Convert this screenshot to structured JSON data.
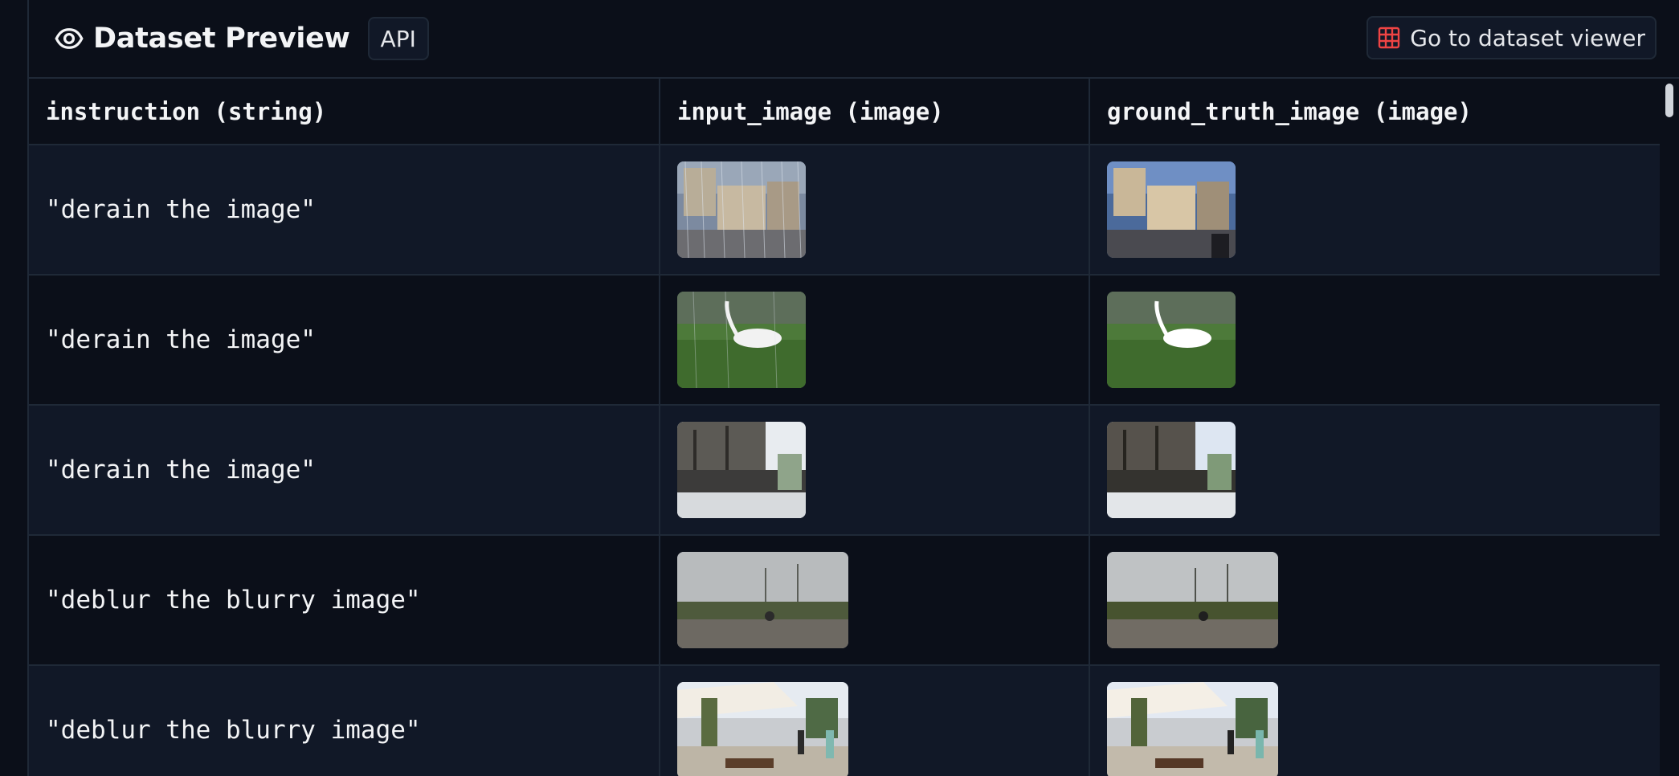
{
  "header": {
    "title": "Dataset Preview",
    "api_label": "API",
    "viewer_button_label": "Go to dataset viewer",
    "eye_icon": "eye-icon",
    "viewer_icon": "grid-icon",
    "viewer_icon_color": "#ef4444"
  },
  "table": {
    "columns": [
      "instruction (string)",
      "input_image (image)",
      "ground_truth_image (image)"
    ],
    "rows": [
      {
        "instruction": "\"derain the image\"",
        "thumb_kind": "city"
      },
      {
        "instruction": "\"derain the image\"",
        "thumb_kind": "egret"
      },
      {
        "instruction": "\"derain the image\"",
        "thumb_kind": "ship"
      },
      {
        "instruction": "\"deblur the blurry image\"",
        "thumb_kind": "field"
      },
      {
        "instruction": "\"deblur the blurry image\"",
        "thumb_kind": "street"
      }
    ]
  }
}
